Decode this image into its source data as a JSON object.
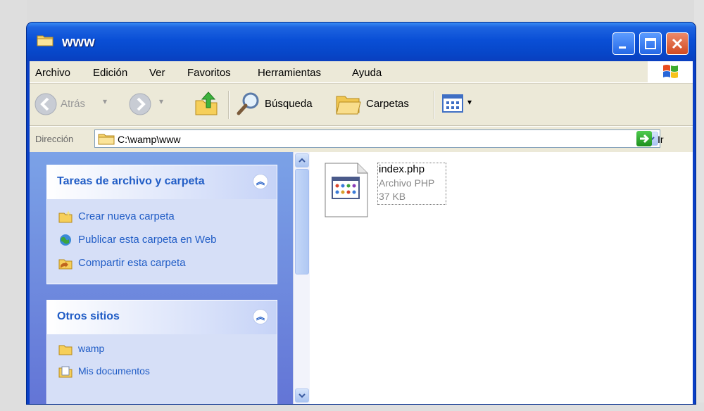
{
  "window": {
    "title": "www"
  },
  "menu": [
    "Archivo",
    "Edición",
    "Ver",
    "Favoritos",
    "Herramientas",
    "Ayuda"
  ],
  "toolbar": {
    "back_label": "Atrás",
    "search_label": "Búsqueda",
    "folders_label": "Carpetas"
  },
  "address": {
    "label": "Dirección",
    "value": "C:\\wamp\\www",
    "go_label": "Ir"
  },
  "sidebar": {
    "file_tasks": {
      "title": "Tareas de archivo y carpeta",
      "items": [
        "Crear nueva carpeta",
        "Publicar esta carpeta en Web",
        "Compartir esta carpeta"
      ]
    },
    "other_places": {
      "title": "Otros sitios",
      "items": [
        "wamp",
        "Mis documentos"
      ]
    }
  },
  "files": [
    {
      "name": "index.php",
      "type": "Archivo PHP",
      "size": "37 KB"
    }
  ],
  "colors": {
    "titlebar": "#0a4fd6",
    "sidebar_link": "#215dc6",
    "close_button": "#d24a22"
  }
}
